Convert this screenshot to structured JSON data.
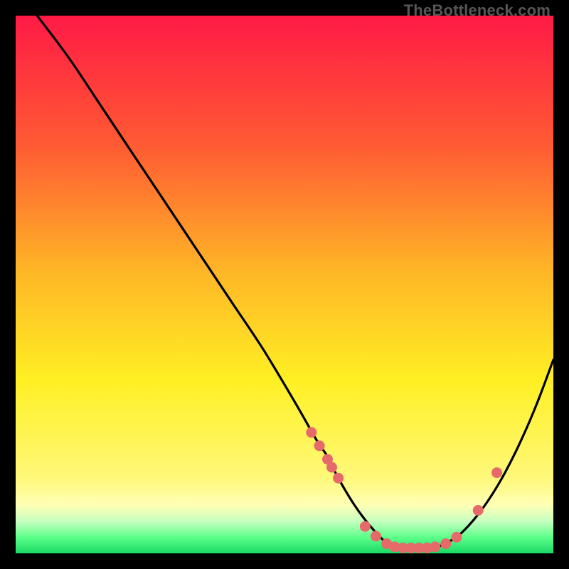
{
  "watermark": "TheBottleneck.com",
  "colors": {
    "grad_top": "#ff1a46",
    "grad_mid1": "#ff7a2e",
    "grad_mid2": "#ffd21f",
    "grad_yellow": "#fff024",
    "grad_pale": "#ffffb5",
    "grad_green1": "#7dff7d",
    "grad_green2": "#18d964",
    "curve": "#000000",
    "marker": "#e76a6a",
    "frame": "#000000"
  },
  "chart_data": {
    "type": "line",
    "title": "",
    "xlabel": "",
    "ylabel": "",
    "xlim": [
      0,
      100
    ],
    "ylim": [
      0,
      100
    ],
    "series": [
      {
        "name": "bottleneck-curve",
        "x": [
          4,
          10,
          16,
          22,
          28,
          34,
          40,
          46,
          52,
          56,
          58,
          60,
          63,
          66,
          69,
          72,
          75,
          78,
          80,
          82,
          85,
          88,
          91,
          94,
          97,
          100
        ],
        "y": [
          100,
          92,
          83,
          74,
          65,
          56,
          47,
          38,
          28,
          21,
          18,
          14,
          9,
          5,
          2,
          1,
          1,
          1,
          2,
          3,
          6,
          10,
          15,
          21,
          28,
          36
        ]
      }
    ],
    "markers": {
      "name": "highlight-points",
      "x": [
        55,
        56.5,
        58,
        58.8,
        60,
        65,
        67,
        69,
        70.5,
        72,
        73.5,
        75,
        76.5,
        78,
        80,
        82,
        86,
        89.5
      ],
      "y": [
        22.5,
        20,
        17.5,
        16,
        14,
        5,
        3.2,
        1.8,
        1.2,
        1,
        1,
        1,
        1,
        1.2,
        1.8,
        3,
        8,
        15
      ]
    }
  }
}
